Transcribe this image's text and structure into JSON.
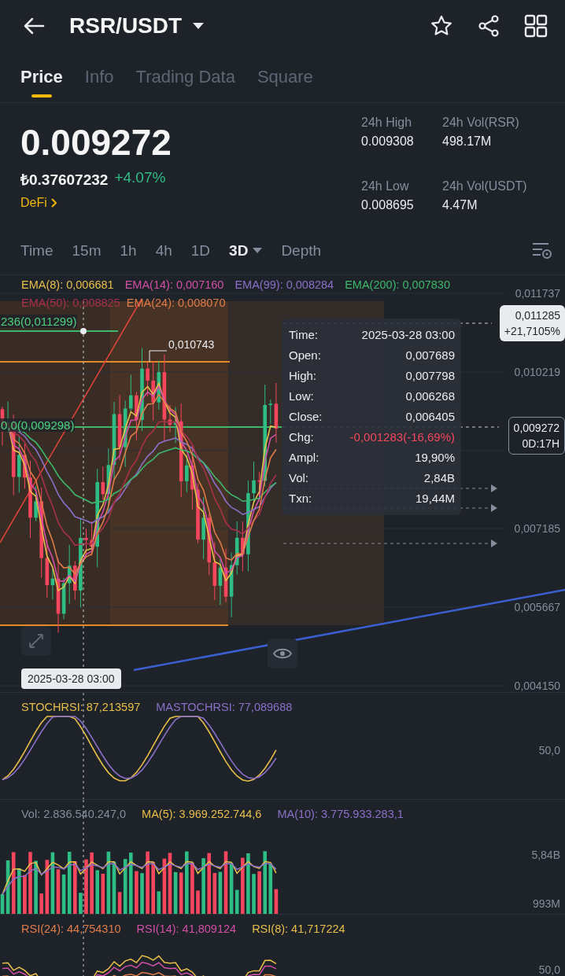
{
  "header": {
    "pair": "RSR/USDT"
  },
  "tabs": [
    {
      "label": "Price",
      "selected": true
    },
    {
      "label": "Info",
      "selected": false
    },
    {
      "label": "Trading Data",
      "selected": false
    },
    {
      "label": "Square",
      "selected": false
    }
  ],
  "price": {
    "last": "0.009272",
    "fiat": "₺0.37607232",
    "change": "+4.07%",
    "category": "DeFi"
  },
  "stats": [
    {
      "label": "24h High",
      "value": "0.009308"
    },
    {
      "label": "24h Vol(RSR)",
      "value": "498.17M"
    },
    {
      "label": "24h Low",
      "value": "0.008695"
    },
    {
      "label": "24h Vol(USDT)",
      "value": "4.47M"
    }
  ],
  "intervals": [
    {
      "label": "Time",
      "selected": false
    },
    {
      "label": "15m",
      "selected": false
    },
    {
      "label": "1h",
      "selected": false
    },
    {
      "label": "4h",
      "selected": false
    },
    {
      "label": "1D",
      "selected": false
    },
    {
      "label": "3D",
      "selected": true
    },
    {
      "label": "Depth",
      "selected": false
    }
  ],
  "chart": {
    "ema_legend": [
      {
        "text": "EMA(8): 0,006681",
        "color": "#e8bf4a"
      },
      {
        "text": "EMA(14): 0,007160",
        "color": "#d24fa6"
      },
      {
        "text": "EMA(99): 0,008284",
        "color": "#8b70c8"
      },
      {
        "text": "EMA(200): 0,007830",
        "color": "#3db86c"
      }
    ],
    "ema_legend_2": [
      {
        "text": "EMA(50): 0,008825",
        "color": "#a8304c"
      },
      {
        "text": "EMA(24): 0,008070",
        "color": "#e07c4a"
      }
    ],
    "price_axis": [
      "0,011737",
      "0,010219",
      "0,007185",
      "0,005667",
      "0,004150"
    ],
    "fib_labels": [
      "236(0,011299)",
      "0,0(0,009298)"
    ],
    "high_marker": "0,010743",
    "tooltip": [
      {
        "label": "Time:",
        "value": "2025-03-28 03:00",
        "kind": "plain"
      },
      {
        "label": "Open:",
        "value": "0,007689",
        "kind": "plain"
      },
      {
        "label": "High:",
        "value": "0,007798",
        "kind": "plain"
      },
      {
        "label": "Low:",
        "value": "0,006268",
        "kind": "plain"
      },
      {
        "label": "Close:",
        "value": "0,006405",
        "kind": "plain"
      },
      {
        "label": "Chg:",
        "value": "-0,001283(-16,69%)",
        "kind": "negative"
      },
      {
        "label": "Ampl:",
        "value": "19,90%",
        "kind": "plain"
      },
      {
        "label": "Vol:",
        "value": "2,84B",
        "kind": "plain"
      },
      {
        "label": "Txn:",
        "value": "19,44M",
        "kind": "plain"
      }
    ],
    "price_tags": [
      {
        "lines": [
          "0,011285",
          "+21,7105%"
        ],
        "kind": "filled"
      },
      {
        "lines": [
          "0,009272",
          "0D:17H"
        ],
        "kind": "outlined"
      }
    ],
    "crosshair_time": "2025-03-28 03:00"
  },
  "stoch": {
    "legend": [
      {
        "text": "STOCHRSI: 87,213597",
        "color": "#e8bf4a"
      },
      {
        "text": "MASTOCHRSI: 77,089688",
        "color": "#8b70c8"
      }
    ],
    "axis": [
      "50,0"
    ]
  },
  "volume": {
    "legend": [
      {
        "text": "Vol: 2.836.540.247,0",
        "color": "#848e9c"
      },
      {
        "text": "MA(5): 3.969.252.744,6",
        "color": "#e8bf4a"
      },
      {
        "text": "MA(10): 3.775.933.283,1",
        "color": "#8b70c8"
      }
    ],
    "axis": [
      "5,84B",
      "993M"
    ]
  },
  "rsi": {
    "legend": [
      {
        "text": "RSI(24): 44,754310",
        "color": "#e07c4a"
      },
      {
        "text": "RSI(14): 41,809124",
        "color": "#d24fa6"
      },
      {
        "text": "RSI(8): 41,717224",
        "color": "#e8bf4a"
      }
    ],
    "axis": [
      "50,0"
    ]
  }
}
